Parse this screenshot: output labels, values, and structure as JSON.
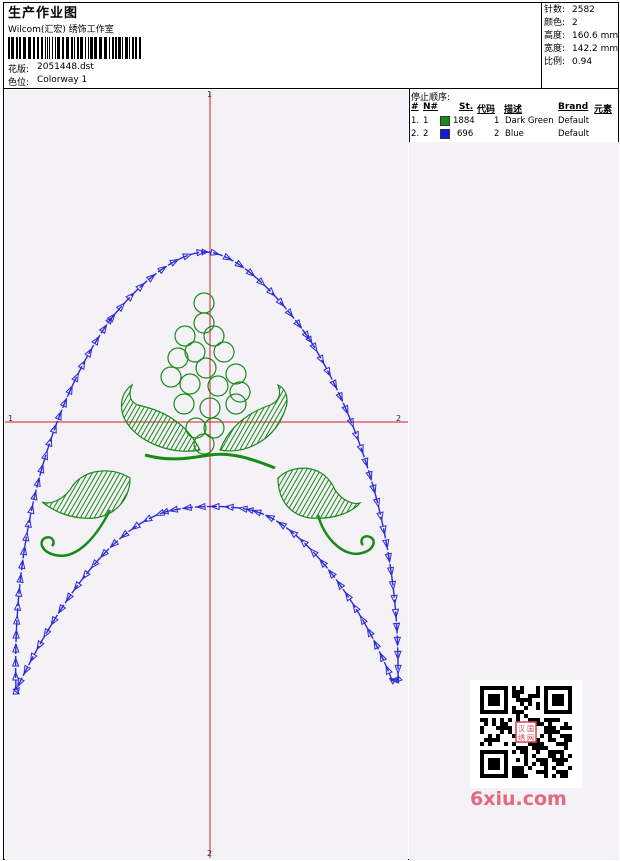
{
  "header": {
    "title": "生产作业图",
    "company": "Wilcom(汇宏) 绣饰工作室",
    "pattern_label": "花版:",
    "pattern_value": "2051448.dst",
    "colorway_label": "色位:",
    "colorway_value": "Colorway 1"
  },
  "stats": {
    "stitches_label": "针数:",
    "stitches_value": "2582",
    "colors_label": "颜色:",
    "colors_value": "2",
    "height_label": "高度:",
    "height_value": "160.6 mm",
    "width_label": "宽度:",
    "width_value": "142.2 mm",
    "scale_label": "比例:",
    "scale_value": "0.94"
  },
  "stop_sequence": {
    "heading": "停止顺序:",
    "columns": [
      "#",
      "N#",
      "St.",
      "代码",
      "描述",
      "Brand",
      "元素"
    ],
    "rows": [
      {
        "num": "1.",
        "n": "1",
        "color": "#1a8a1a",
        "st": "1884",
        "code": "1",
        "desc": "Dark Green",
        "brand": "Default"
      },
      {
        "num": "2.",
        "n": "2",
        "color": "#0a1ae0",
        "st": "696",
        "code": "2",
        "desc": "Blue",
        "brand": "Default"
      }
    ]
  },
  "axes": {
    "top": "1",
    "left": "1",
    "right": "2",
    "bottom": "2"
  },
  "colors": {
    "outline": "#2a2ad8",
    "leaf": "#1a8a1a",
    "crosshair": "#d42020"
  },
  "watermark": {
    "text": "6xiu.com",
    "qr_stamp": [
      "汉",
      "国",
      "绣",
      "网"
    ]
  }
}
